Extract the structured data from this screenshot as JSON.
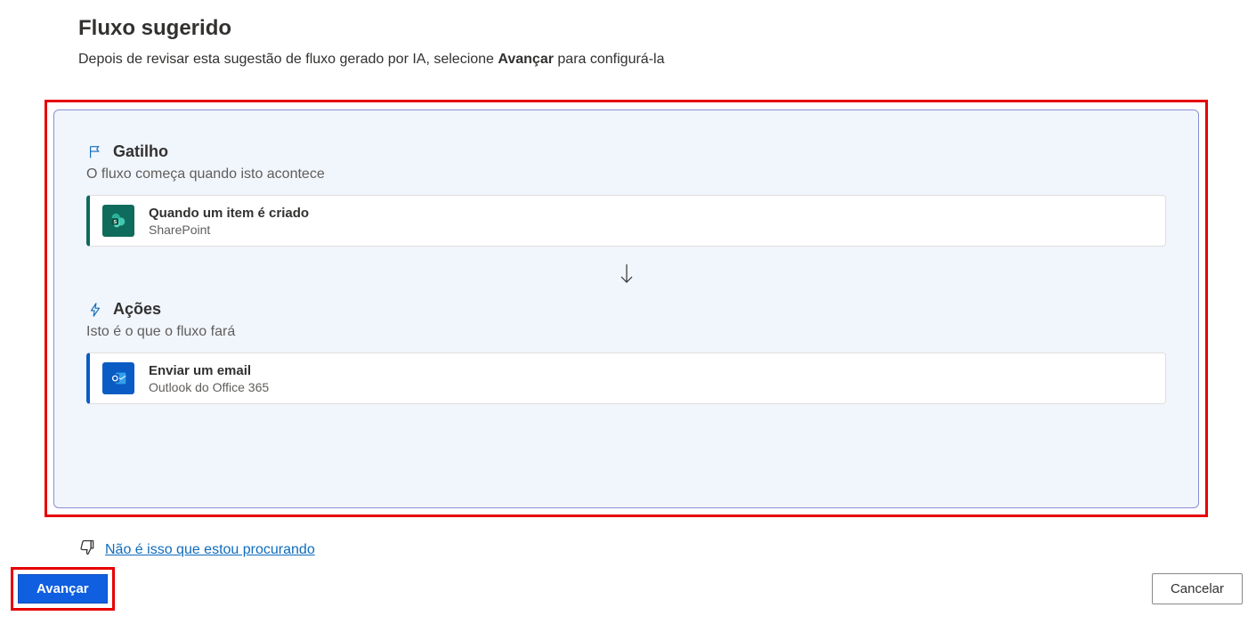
{
  "header": {
    "title": "Fluxo sugerido",
    "description_pre": "Depois de revisar esta sugestão de fluxo gerado por IA, selecione ",
    "description_bold": "Avançar",
    "description_post": " para configurá-la"
  },
  "trigger": {
    "label": "Gatilho",
    "description": "O fluxo começa quando isto acontece",
    "step_title": "Quando um item é criado",
    "step_service": "SharePoint"
  },
  "actions": {
    "label": "Ações",
    "description": "Isto é o que o fluxo fará",
    "step_title": "Enviar um email",
    "step_service": "Outlook do Office 365"
  },
  "feedback": {
    "link_label": "Não é isso que estou procurando"
  },
  "buttons": {
    "primary": "Avançar",
    "secondary": "Cancelar"
  }
}
